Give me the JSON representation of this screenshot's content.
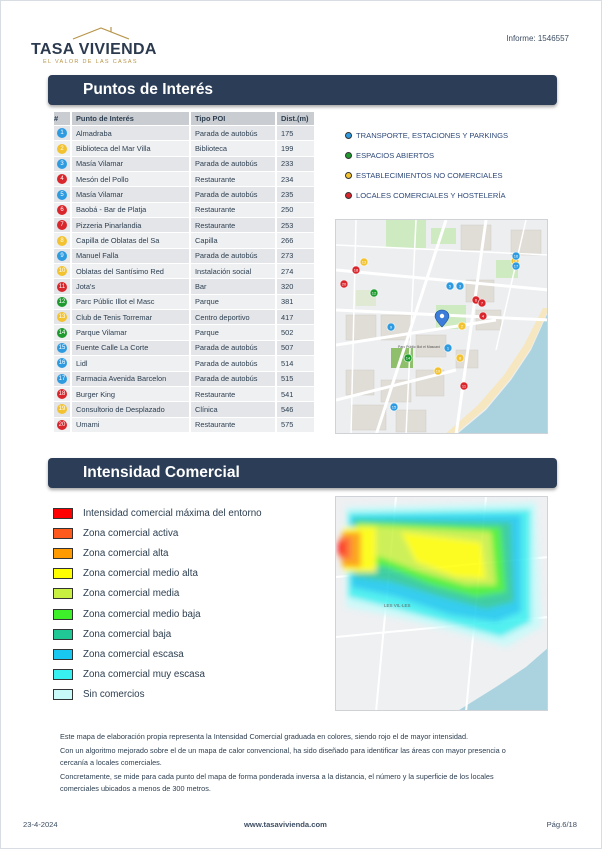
{
  "header": {
    "logo_name": "TASA VIVIENDA",
    "logo_tagline": "EL VALOR DE LAS CASAS",
    "informe": "Informe: 1546557"
  },
  "poi_section": {
    "title": "Puntos de Interés",
    "columns": [
      "#",
      "Punto de Interés",
      "Tipo POI",
      "Dist.(m)"
    ],
    "rows": [
      {
        "n": "1",
        "name": "Almadraba",
        "type": "Parada de autobús",
        "dist": "175",
        "cat": "blue"
      },
      {
        "n": "2",
        "name": "Biblioteca del Mar Villa",
        "type": "Biblioteca",
        "dist": "199",
        "cat": "yellow"
      },
      {
        "n": "3",
        "name": "Masía Vilamar",
        "type": "Parada de autobús",
        "dist": "233",
        "cat": "blue"
      },
      {
        "n": "4",
        "name": "Mesón del Pollo",
        "type": "Restaurante",
        "dist": "234",
        "cat": "red"
      },
      {
        "n": "5",
        "name": "Masía Vilamar",
        "type": "Parada de autobús",
        "dist": "235",
        "cat": "blue"
      },
      {
        "n": "6",
        "name": "Baobá - Bar de Platja",
        "type": "Restaurante",
        "dist": "250",
        "cat": "red"
      },
      {
        "n": "7",
        "name": "Pizzeria Pinarlandia",
        "type": "Restaurante",
        "dist": "253",
        "cat": "red"
      },
      {
        "n": "8",
        "name": "Capilla de Oblatas del Sa",
        "type": "Capilla",
        "dist": "266",
        "cat": "yellow"
      },
      {
        "n": "9",
        "name": "Manuel Falla",
        "type": "Parada de autobús",
        "dist": "273",
        "cat": "blue"
      },
      {
        "n": "10",
        "name": "Oblatas del Santísimo Red",
        "type": "Instalación social",
        "dist": "274",
        "cat": "yellow"
      },
      {
        "n": "11",
        "name": "Jota's",
        "type": "Bar",
        "dist": "320",
        "cat": "red"
      },
      {
        "n": "12",
        "name": "Parc Públic Illot el Masc",
        "type": "Parque",
        "dist": "381",
        "cat": "green"
      },
      {
        "n": "13",
        "name": "Club de Tenis Torremar",
        "type": "Centro deportivo",
        "dist": "417",
        "cat": "yellow"
      },
      {
        "n": "14",
        "name": "Parque Vilamar",
        "type": "Parque",
        "dist": "502",
        "cat": "green"
      },
      {
        "n": "15",
        "name": "Fuente Calle La Corte",
        "type": "Parada de autobús",
        "dist": "507",
        "cat": "blue"
      },
      {
        "n": "16",
        "name": "Lidl",
        "type": "Parada de autobús",
        "dist": "514",
        "cat": "blue"
      },
      {
        "n": "17",
        "name": "Farmacia Avenida Barcelon",
        "type": "Parada de autobús",
        "dist": "515",
        "cat": "blue"
      },
      {
        "n": "18",
        "name": "Burger King",
        "type": "Restaurante",
        "dist": "541",
        "cat": "red"
      },
      {
        "n": "19",
        "name": "Consultorio de Desplazado",
        "type": "Clínica",
        "dist": "546",
        "cat": "yellow"
      },
      {
        "n": "20",
        "name": "Umami",
        "type": "Restaurante",
        "dist": "575",
        "cat": "red"
      }
    ],
    "legend": [
      {
        "label": "TRANSPORTE, ESTACIONES Y PARKINGS",
        "color": "#2e9be0"
      },
      {
        "label": "ESPACIOS ABIERTOS",
        "color": "#1e9a2e"
      },
      {
        "label": "ESTABLECIMIENTOS NO COMERCIALES",
        "color": "#f2c230"
      },
      {
        "label": "LOCALES COMERCIALES Y HOSTELERÍA",
        "color": "#d9262c"
      }
    ],
    "category_colors": {
      "blue": "#2e9be0",
      "green": "#1e9a2e",
      "yellow": "#f2c230",
      "red": "#d9262c"
    },
    "map_labels": {
      "park": "Parc Públic Illot el Mascaró"
    }
  },
  "commercial_section": {
    "title": "Intensidad Comercial",
    "legend": [
      {
        "label": "Intensidad comercial máxima del entorno",
        "color": "#ff0000"
      },
      {
        "label": "Zona comercial activa",
        "color": "#ff5a1e"
      },
      {
        "label": "Zona comercial alta",
        "color": "#ff9a00"
      },
      {
        "label": "Zona comercial medio alta",
        "color": "#ffff00"
      },
      {
        "label": "Zona comercial media",
        "color": "#c8f040"
      },
      {
        "label": "Zona comercial medio baja",
        "color": "#3ef02a"
      },
      {
        "label": "Zona comercial baja",
        "color": "#20c896"
      },
      {
        "label": "Zona comercial escasa",
        "color": "#18c8f0"
      },
      {
        "label": "Zona comercial muy escasa",
        "color": "#38f0f0"
      },
      {
        "label": "Sin comercios",
        "color": "#c8fafa"
      }
    ],
    "map_label": "LES VIL·LES",
    "description": [
      "Este mapa de elaboración propia representa la Intensidad Comercial graduada en colores, siendo rojo el de mayor intensidad.",
      "Con un algoritmo mejorado sobre el de un mapa de calor convencional, ha sido diseñado para identificar las áreas con mayor presencia o cercanía a locales comerciales.",
      "Concretamente, se mide para cada punto del mapa de forma ponderada inversa a la distancia, el número y la superficie de los locales comerciales ubicados a menos de 300 metros."
    ]
  },
  "footer": {
    "date": "23-4-2024",
    "website": "www.tasavivienda.com",
    "page": "Pág.6/18"
  }
}
